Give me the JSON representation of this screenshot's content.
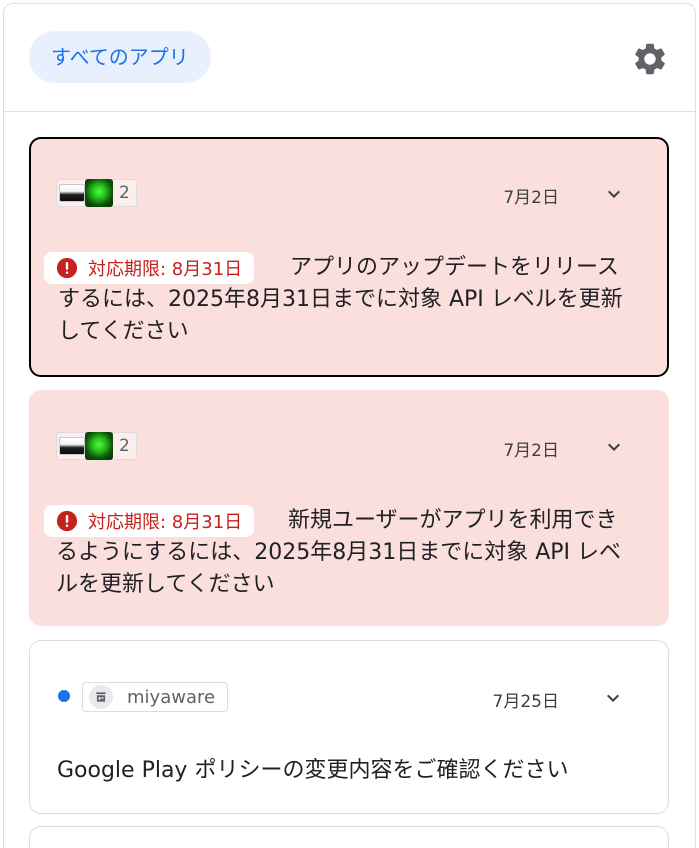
{
  "header": {
    "filter_chip_label": "すべてのアプリ",
    "settings_icon": "gear-icon"
  },
  "cards": [
    {
      "app_count": "2",
      "date": "7月2日",
      "deadline_label": "対応期限: 8月31日",
      "message_line1": "アプリのアップデートをリリース",
      "message_line2": "するには、2025年8月31日までに対象 API レベルを更新",
      "message_line3": "してください"
    },
    {
      "app_count": "2",
      "date": "7月2日",
      "deadline_label": "対応期限: 8月31日",
      "message_line1": "新規ユーザーがアプリを利用でき",
      "message_line2": "るようにするには、2025年8月31日までに対象 API レベ",
      "message_line3": "ルを更新してください"
    },
    {
      "account_name": "miyaware",
      "date": "7月25日",
      "message": "Google Play ポリシーの変更内容をご確認ください"
    }
  ],
  "colors": {
    "accent": "#1a73e8",
    "alert_background": "#fadfdc",
    "deadline_text": "#c5221f"
  }
}
